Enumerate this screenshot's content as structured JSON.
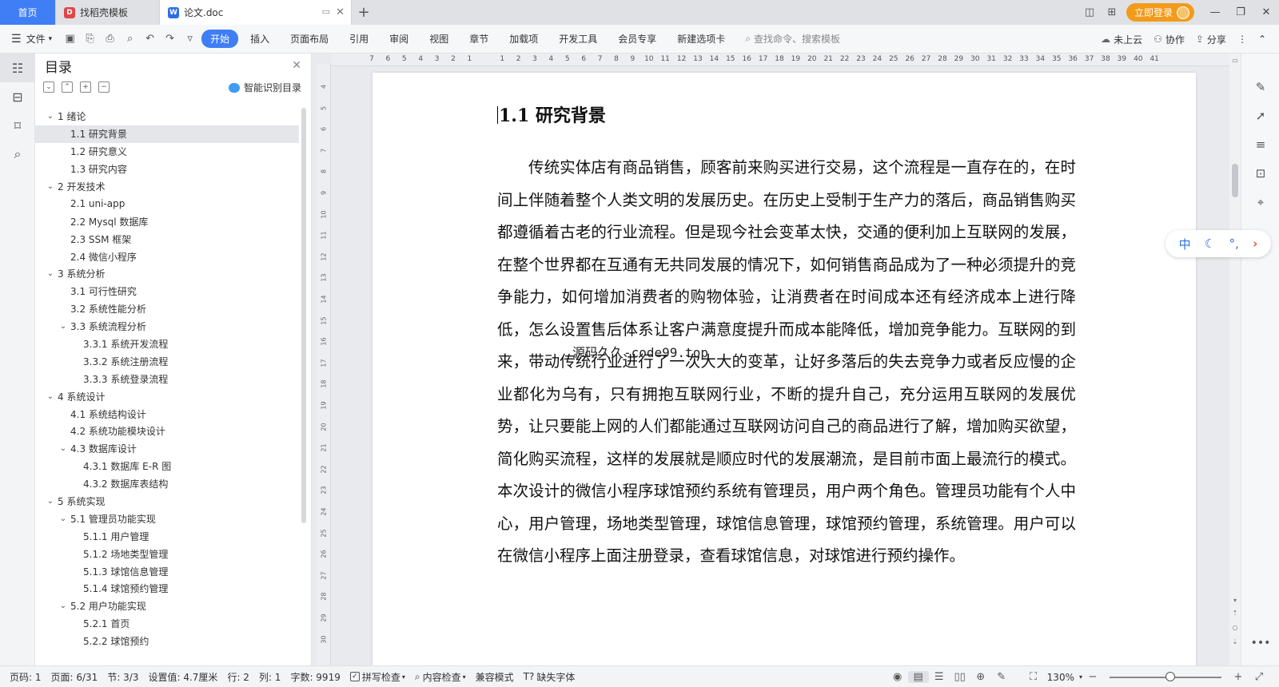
{
  "tabs": [
    {
      "label": "首页"
    },
    {
      "label": "找稻壳模板"
    },
    {
      "label": "论文.doc"
    }
  ],
  "header": {
    "login_label": "立即登录"
  },
  "menubar": {
    "file_label": "文件",
    "items": [
      "开始",
      "插入",
      "页面布局",
      "引用",
      "审阅",
      "视图",
      "章节",
      "加载项",
      "开发工具",
      "会员专享",
      "新建选项卡"
    ],
    "search_placeholder": "查找命令、搜索模板",
    "cloud_label": "未上云",
    "collab_label": "协作",
    "share_label": "分享"
  },
  "toc": {
    "title": "目录",
    "smart_label": "智能识别目录",
    "items": [
      {
        "label": "1 绪论",
        "level": 1,
        "expanded": true
      },
      {
        "label": "1.1 研究背景",
        "level": 2,
        "selected": true
      },
      {
        "label": "1.2 研究意义",
        "level": 2
      },
      {
        "label": "1.3 研究内容",
        "level": 2
      },
      {
        "label": "2 开发技术",
        "level": 1,
        "expanded": true
      },
      {
        "label": "2.1 uni-app",
        "level": 2
      },
      {
        "label": "2.2 Mysql 数据库",
        "level": 2
      },
      {
        "label": "2.3 SSM 框架",
        "level": 2
      },
      {
        "label": "2.4 微信小程序",
        "level": 2
      },
      {
        "label": "3 系统分析",
        "level": 1,
        "expanded": true
      },
      {
        "label": "3.1 可行性研究",
        "level": 2
      },
      {
        "label": "3.2 系统性能分析",
        "level": 2
      },
      {
        "label": "3.3 系统流程分析",
        "level": 2,
        "expanded": true
      },
      {
        "label": "3.3.1 系统开发流程",
        "level": 3
      },
      {
        "label": "3.3.2 系统注册流程",
        "level": 3
      },
      {
        "label": "3.3.3 系统登录流程",
        "level": 3
      },
      {
        "label": "4 系统设计",
        "level": 1,
        "expanded": true
      },
      {
        "label": "4.1 系统结构设计",
        "level": 2
      },
      {
        "label": "4.2 系统功能模块设计",
        "level": 2
      },
      {
        "label": "4.3 数据库设计",
        "level": 2,
        "expanded": true
      },
      {
        "label": "4.3.1 数据库 E-R 图",
        "level": 3
      },
      {
        "label": "4.3.2 数据库表结构",
        "level": 3
      },
      {
        "label": "5 系统实现",
        "level": 1,
        "expanded": true
      },
      {
        "label": "5.1 管理员功能实现",
        "level": 2,
        "expanded": true
      },
      {
        "label": "5.1.1 用户管理",
        "level": 3
      },
      {
        "label": "5.1.2 场地类型管理",
        "level": 3
      },
      {
        "label": "5.1.3 球馆信息管理",
        "level": 3
      },
      {
        "label": "5.1.4 球馆预约管理",
        "level": 3
      },
      {
        "label": "5.2 用户功能实现",
        "level": 2,
        "expanded": true
      },
      {
        "label": "5.2.1 首页",
        "level": 3
      },
      {
        "label": "5.2.2 球馆预约",
        "level": 3
      }
    ]
  },
  "ruler": {
    "h_ticks": [
      "7",
      "6",
      "5",
      "4",
      "3",
      "2",
      "1",
      "",
      "1",
      "2",
      "3",
      "4",
      "5",
      "6",
      "7",
      "8",
      "9",
      "10",
      "11",
      "12",
      "13",
      "14",
      "15",
      "16",
      "17",
      "18",
      "19",
      "20",
      "21",
      "22",
      "23",
      "24",
      "25",
      "26",
      "27",
      "28",
      "29",
      "30",
      "31",
      "32",
      "33",
      "34",
      "35",
      "36",
      "37",
      "38",
      "39",
      "40",
      "41"
    ],
    "v_ticks": [
      "4",
      "5",
      "6",
      "7",
      "8",
      "9",
      "10",
      "11",
      "12",
      "13",
      "14",
      "15",
      "16",
      "17",
      "18",
      "19",
      "20",
      "21",
      "22",
      "23",
      "24",
      "25",
      "26",
      "27",
      "28",
      "29",
      "30"
    ]
  },
  "document": {
    "heading": "1.1  研究背景",
    "body": "传统实体店有商品销售，顾客前来购买进行交易，这个流程是一直存在的，在时间上伴随着整个人类文明的发展历史。在历史上受制于生产力的落后，商品销售购买都遵循着古老的行业流程。但是现今社会变革太快，交通的便利加上互联网的发展，在整个世界都在互通有无共同发展的情况下，如何销售商品成为了一种必须提升的竞争能力，如何增加消费者的购物体验，让消费者在时间成本还有经济成本上进行降低，怎么设置售后体系让客户满意度提升而成本能降低，增加竞争能力。互联网的到来，带动传统行业进行了一次大大的变革，让好多落后的失去竞争力或者反应慢的企业都化为乌有，只有拥抱互联网行业，不断的提升自己，充分运用互联网的发展优势，让只要能上网的人们都能通过互联网访问自己的商品进行了解，增加购买欲望，简化购买流程，这样的发展就是顺应时代的发展潮流，是目前市面上最流行的模式。本次设计的微信小程序球馆预约系统有管理员，用户两个角色。管理员功能有个人中心，用户管理，场地类型管理，球馆信息管理，球馆预约管理，系统管理。用户可以在微信小程序上面注册登录，查看球馆信息，对球馆进行预约操作。",
    "watermark": "源码久久-code99.top"
  },
  "ime": {
    "mode_label": "中"
  },
  "statusbar": {
    "page_no": "页码: 1",
    "pages": "页面: 6/31",
    "section": "节: 3/3",
    "setting": "设置值: 4.7厘米",
    "row": "行: 2",
    "col": "列: 1",
    "word_count": "字数: 9919",
    "spell_check": "拼写检查",
    "content_check": "内容检查",
    "compat_mode": "兼容模式",
    "missing_font": "缺失字体",
    "zoom": "130%"
  },
  "colors": {
    "accent": "#3f7ef5",
    "login": "#f29b1a"
  }
}
